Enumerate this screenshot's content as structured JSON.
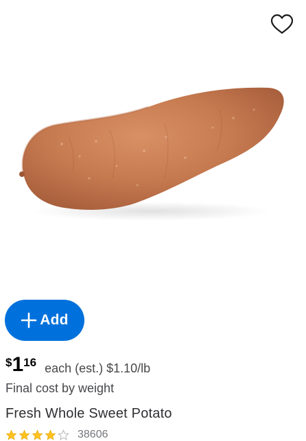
{
  "product": {
    "title": "Fresh Whole Sweet Potato",
    "image_alt": "sweet potato",
    "favorite_icon": "heart-outline-icon"
  },
  "actions": {
    "add_label": "Add",
    "add_icon": "plus-icon"
  },
  "price": {
    "currency_symbol": "$",
    "dollars": "1",
    "cents": "16",
    "unit_text": "each (est.) $1.10/lb",
    "weight_note": "Final cost by weight"
  },
  "rating": {
    "stars_value": 4,
    "stars_max": 5,
    "review_count": "38606"
  },
  "colors": {
    "brand_blue": "#0071dc",
    "star_gold": "#ffc220",
    "text_primary": "#2e2f32",
    "text_secondary": "#46474a"
  }
}
